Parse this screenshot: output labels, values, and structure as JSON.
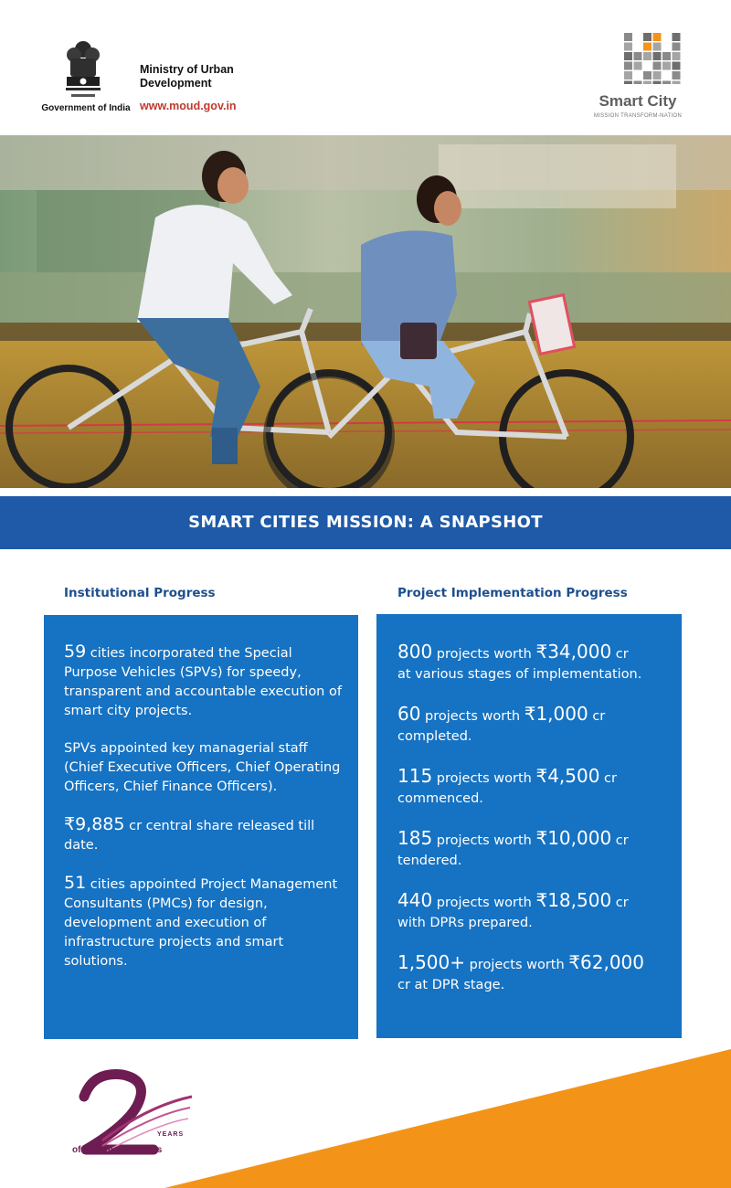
{
  "header": {
    "gov_label": "Government of India",
    "ministry_name": "Ministry of Urban Development",
    "ministry_url": "www.moud.gov.in",
    "smart_city_title": "Smart City",
    "smart_city_tagline": "MISSION TRANSFORM-NATION",
    "emblem_icon": "national-emblem-icon",
    "smart_city_icon": "smart-city-logo-icon"
  },
  "hero": {
    "image_subject": "two women riding bicycles"
  },
  "banner": {
    "title": "SMART CITIES MISSION: A SNAPSHOT"
  },
  "institutional": {
    "heading": "Institutional Progress",
    "items": [
      {
        "number": "59",
        "text": " cities incorporated the Special Purpose Vehicles (SPVs) for speedy, transparent and accountable execution of smart city projects."
      },
      {
        "number": "",
        "text": "SPVs appointed key managerial staff (Chief Executive Officers, Chief Operating Officers, Chief Finance Officers)."
      },
      {
        "number": "₹9,885",
        "text": " cr central share released till date."
      },
      {
        "number": "51",
        "text": " cities appointed Project Management Consultants (PMCs) for design, development and execution of infrastructure projects and smart solutions."
      }
    ]
  },
  "implementation": {
    "heading": "Project Implementation Progress",
    "items": [
      {
        "count": "800",
        "mid": " projects worth ",
        "amount": "₹34,000",
        "unit": " cr",
        "rest": "at various stages of implementation."
      },
      {
        "count": "60",
        "mid": " projects worth ",
        "amount": "₹1,000",
        "unit": " cr",
        "rest": "completed."
      },
      {
        "count": "115",
        "mid": " projects worth ",
        "amount": "₹4,500",
        "unit": " cr",
        "rest": "commenced."
      },
      {
        "count": "185",
        "mid": " projects worth ",
        "amount": "₹10,000",
        "unit": " cr",
        "rest": "tendered."
      },
      {
        "count": "440",
        "mid": " projects worth ",
        "amount": "₹18,500",
        "unit": " cr",
        "rest": "with DPRs prepared."
      },
      {
        "count": "1,500+",
        "mid": " projects worth ",
        "amount": "₹62,000",
        "unit": "",
        "rest": "cr at DPR stage."
      }
    ]
  },
  "footer": {
    "years_label": "YEARS",
    "promise_label": "of fulfilling promises",
    "logo_icon": "two-years-logo-icon",
    "colors": {
      "orange": "#f39419",
      "purple": "#6d1d52",
      "blue": "#1672c2",
      "banner_blue": "#1e5aa8"
    }
  }
}
